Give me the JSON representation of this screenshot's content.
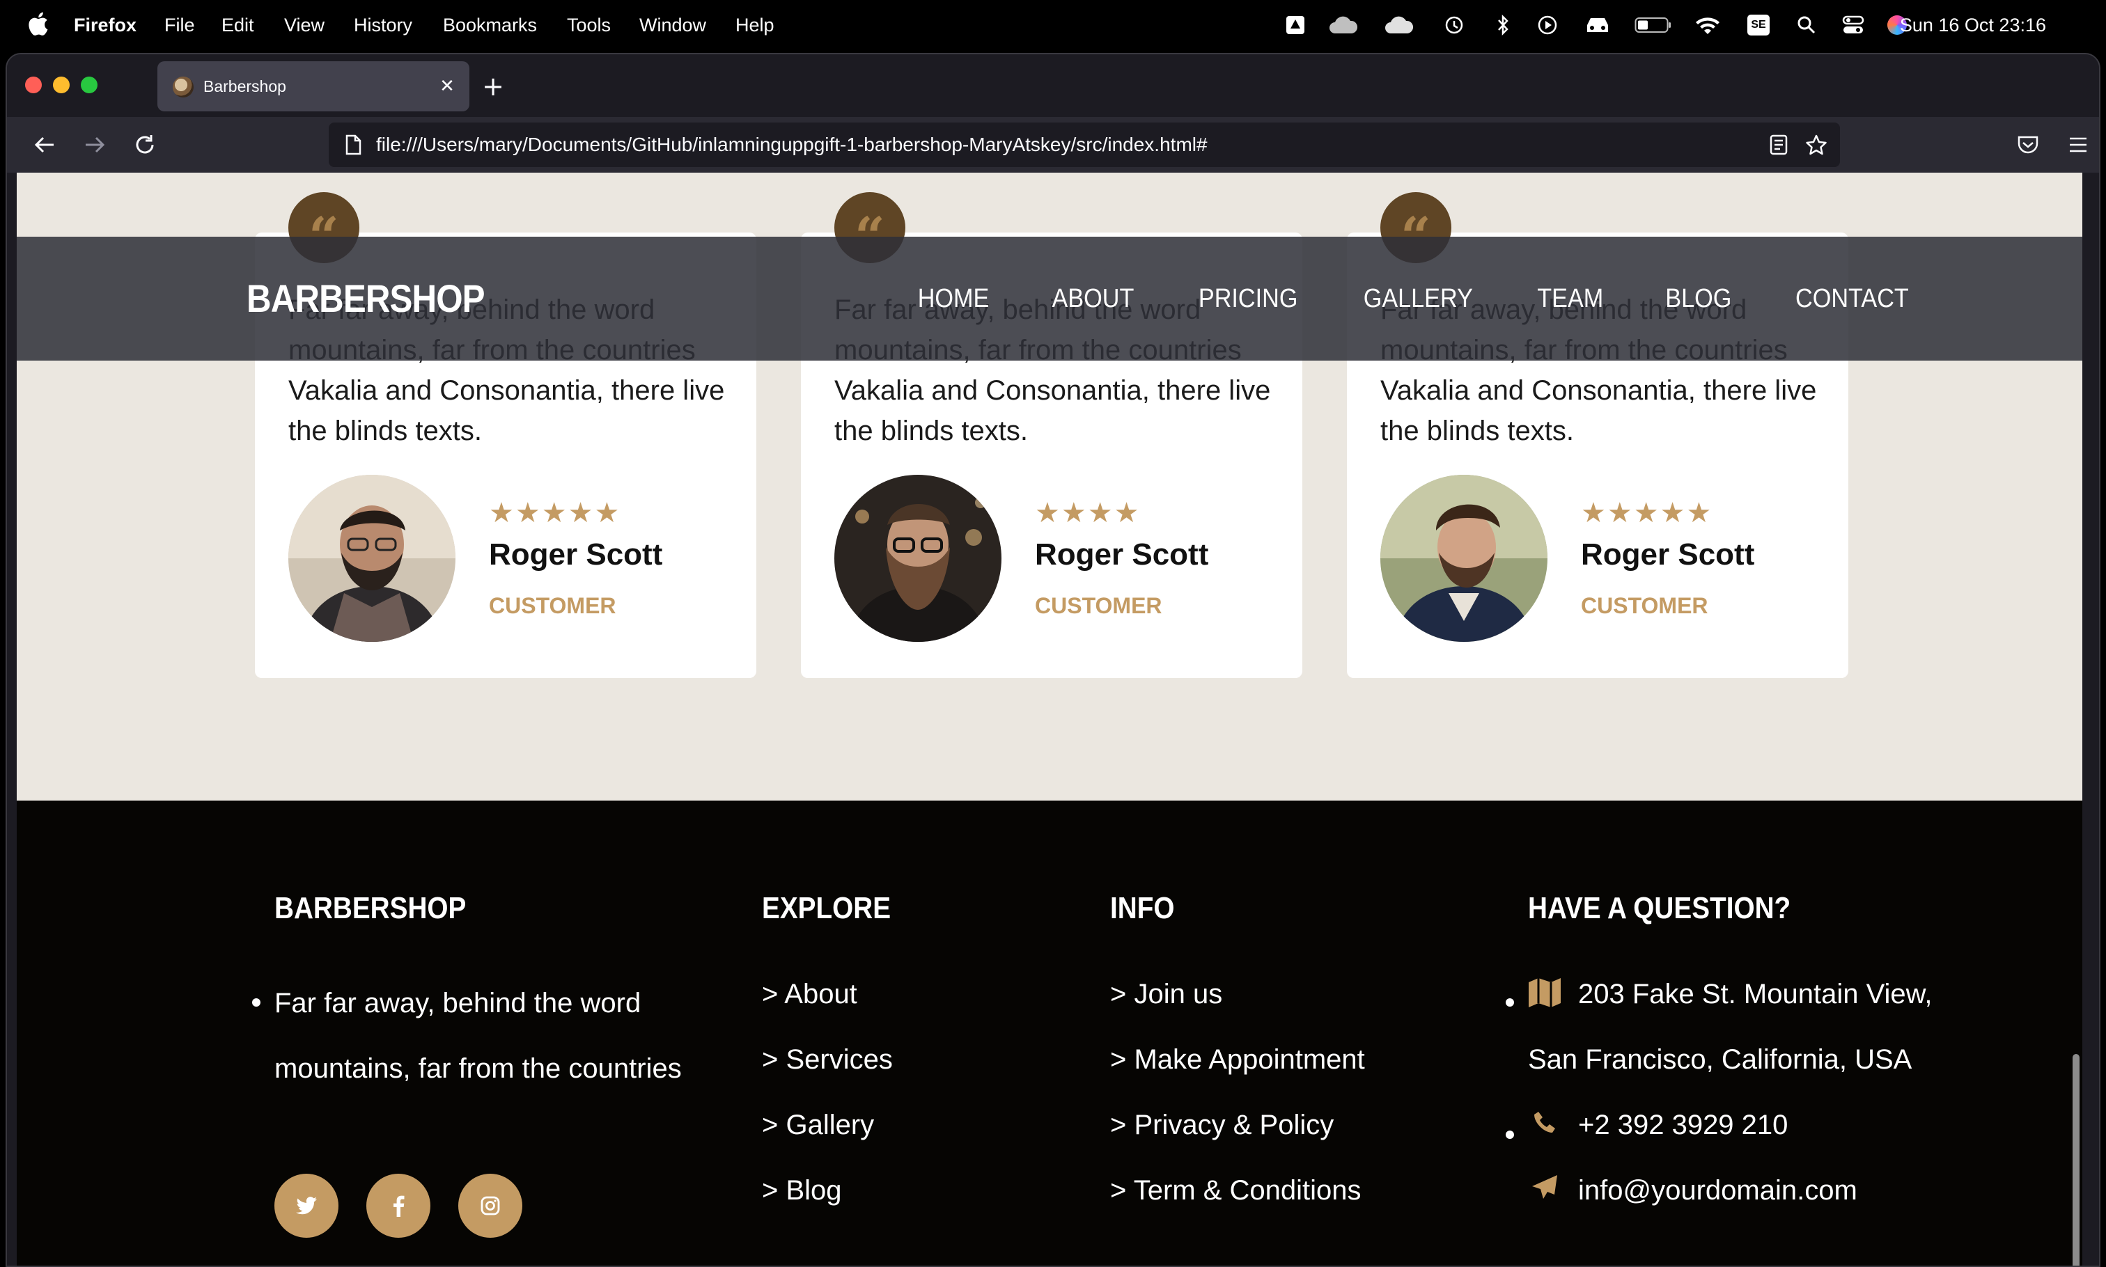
{
  "menubar": {
    "app": "Firefox",
    "items": [
      "File",
      "Edit",
      "View",
      "History",
      "Bookmarks",
      "Tools",
      "Window",
      "Help"
    ],
    "clock": "Sun 16 Oct  23:16",
    "status_icons": [
      "drive-icon",
      "cloud-icon",
      "cloud-filled-icon",
      "time-machine-icon",
      "bluetooth-icon",
      "play-icon",
      "car-icon",
      "battery-icon",
      "wifi-icon",
      "se-badge-icon",
      "search-icon",
      "control-center-icon",
      "siri-icon"
    ],
    "se_label": "SE"
  },
  "browser": {
    "tab_title": "Barbershop",
    "url": "file:///Users/mary/Documents/GitHub/inlamninguppgift-1-barbershop-MaryAtskey/src/index.html#"
  },
  "site": {
    "logo": "BARBERSHOP",
    "nav": [
      "HOME",
      "ABOUT",
      "PRICING",
      "GALLERY",
      "TEAM",
      "BLOG",
      "CONTACT"
    ]
  },
  "testimonials": [
    {
      "text": "Far far away, behind the word mountains, far from the countries Vakalia and Consonantia, there live the blinds texts.",
      "stars": "★★★★★",
      "rating": 5,
      "name": "Roger Scott",
      "role": "CUSTOMER"
    },
    {
      "text": "Far far away, behind the word mountains, far from the countries Vakalia and Consonantia, there live the blinds texts.",
      "stars": "★★★★",
      "rating": 4,
      "name": "Roger Scott",
      "role": "CUSTOMER"
    },
    {
      "text": "Far far away, behind the word mountains, far from the countries Vakalia and Consonantia, there live the blinds texts.",
      "stars": "★★★★★",
      "rating": 5,
      "name": "Roger Scott",
      "role": "CUSTOMER"
    }
  ],
  "footer": {
    "col1": {
      "title": "BARBERSHOP",
      "text": "Far far away, behind the word mountains, far from the countries"
    },
    "col2": {
      "title": "EXPLORE",
      "links": [
        "> About",
        "> Services",
        "> Gallery",
        "> Blog"
      ]
    },
    "col3": {
      "title": "INFO",
      "links": [
        "> Join us",
        "> Make Appointment",
        "> Privacy & Policy",
        "> Term & Conditions"
      ]
    },
    "col4": {
      "title": "HAVE A QUESTION?",
      "address_line1": "203 Fake St. Mountain View,",
      "address_line2": "San Francisco, California, USA",
      "phone": "+2 392 3929 210",
      "email": "info@yourdomain.com"
    },
    "social": [
      "twitter-icon",
      "facebook-icon",
      "instagram-icon"
    ]
  },
  "colors": {
    "accent": "#c49b63",
    "footer_bg": "#060503",
    "section_bg": "#ebe7e0",
    "quote_bg": "#5f4525"
  }
}
